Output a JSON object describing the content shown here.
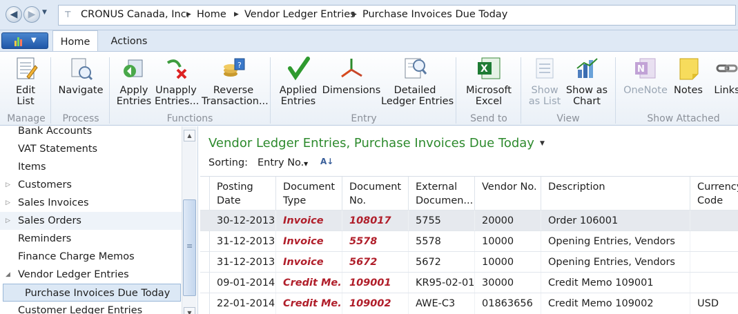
{
  "address": {
    "crumbs": [
      "CRONUS Canada, Inc.",
      "Home",
      "Vendor Ledger Entries",
      "Purchase Invoices Due Today"
    ]
  },
  "tabs": {
    "home": "Home",
    "actions": "Actions"
  },
  "ribbon": {
    "buttons": {
      "edit_list": "Edit\nList",
      "navigate": "Navigate",
      "apply_entries": "Apply\nEntries",
      "unapply_entries": "Unapply\nEntries...",
      "reverse_transaction": "Reverse\nTransaction...",
      "applied_entries": "Applied\nEntries",
      "dimensions": "Dimensions",
      "detailed_ledger_entries": "Detailed\nLedger Entries",
      "microsoft_excel": "Microsoft\nExcel",
      "show_as_list": "Show\nas List",
      "show_as_chart": "Show as\nChart",
      "onenote": "OneNote",
      "notes": "Notes",
      "links": "Links"
    },
    "groups": {
      "manage": "Manage",
      "process": "Process",
      "functions": "Functions",
      "entry": "Entry",
      "send_to": "Send to",
      "view": "View",
      "show_attached": "Show Attached"
    }
  },
  "nav": {
    "items": [
      {
        "label": "Bank Accounts",
        "arrow": ""
      },
      {
        "label": "VAT Statements",
        "arrow": ""
      },
      {
        "label": "Items",
        "arrow": ""
      },
      {
        "label": "Customers",
        "arrow": "▷"
      },
      {
        "label": "Sales Invoices",
        "arrow": "▷"
      },
      {
        "label": "Sales Orders",
        "arrow": "▷"
      },
      {
        "label": "Reminders",
        "arrow": ""
      },
      {
        "label": "Finance Charge Memos",
        "arrow": ""
      },
      {
        "label": "Vendor Ledger Entries",
        "arrow": "◢"
      },
      {
        "label": "Purchase Invoices Due Today",
        "arrow": ""
      },
      {
        "label": "Customer Ledger Entries",
        "arrow": ""
      }
    ]
  },
  "content": {
    "title": "Vendor Ledger Entries, Purchase Invoices Due Today",
    "sorting_label": "Sorting:",
    "sorting_value": "Entry No.",
    "columns": [
      "Posting\nDate",
      "Document\nType",
      "Document\nNo.",
      "External\nDocumen...",
      "Vendor No.",
      "Description",
      "Currency\nCode"
    ],
    "rows": [
      [
        "30-12-2013",
        "Invoice",
        "108017",
        "5755",
        "20000",
        "Order 106001",
        ""
      ],
      [
        "31-12-2013",
        "Invoice",
        "5578",
        "5578",
        "10000",
        "Opening Entries, Vendors",
        ""
      ],
      [
        "31-12-2013",
        "Invoice",
        "5672",
        "5672",
        "10000",
        "Opening Entries, Vendors",
        ""
      ],
      [
        "09-01-2014",
        "Credit Me...",
        "109001",
        "KR95-02-01",
        "30000",
        "Credit Memo 109001",
        ""
      ],
      [
        "22-01-2014",
        "Credit Me...",
        "109002",
        "AWE-C3",
        "01863656",
        "Credit Memo 109002",
        "USD"
      ]
    ]
  },
  "colors": {
    "title": "#2d8a2d",
    "doc_red": "#b01e2a"
  }
}
